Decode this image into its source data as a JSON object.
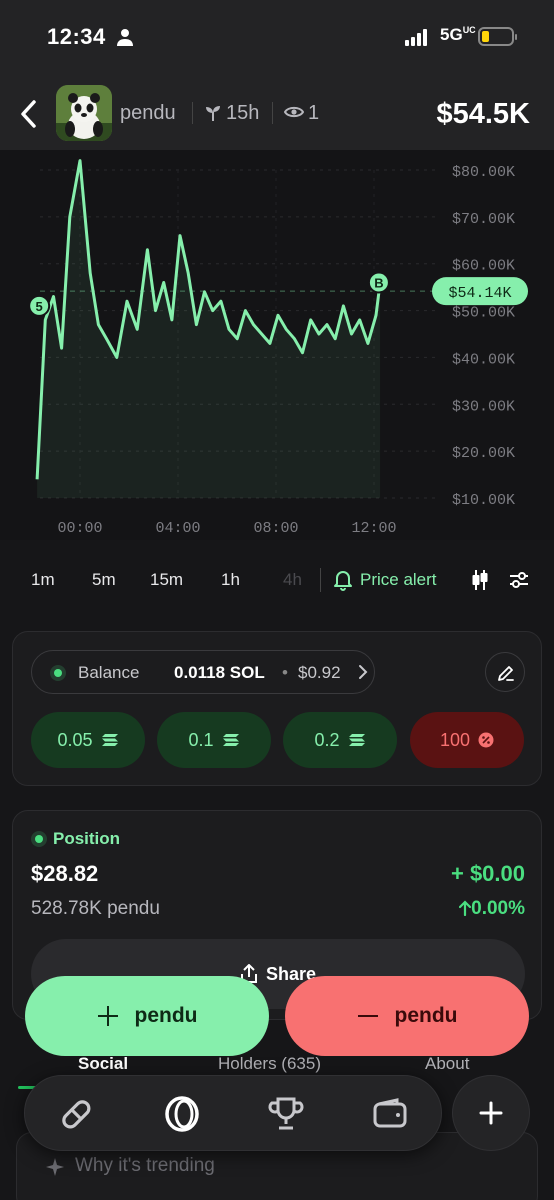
{
  "status_bar": {
    "time": "12:34",
    "network": "5G",
    "network_sub": "UC"
  },
  "header": {
    "token_name": "pendu",
    "age": "15h",
    "viewers": "1",
    "market_cap": "$54.5K"
  },
  "chart_data": {
    "type": "line",
    "y_ticks": [
      "$80.00K",
      "$70.00K",
      "$60.00K",
      "$50.00K",
      "$40.00K",
      "$30.00K",
      "$20.00K",
      "$10.00K"
    ],
    "x_ticks": [
      "00:00",
      "04:00",
      "08:00",
      "12:00"
    ],
    "ylim": [
      10000,
      80000
    ],
    "current_price_label": "$54.14K",
    "current_price": 54140,
    "line_color": "#86efac",
    "markers": [
      {
        "label": "5",
        "time": "-01:40",
        "value": 51000
      },
      {
        "label": "B",
        "time": "12:12",
        "value": 56000
      }
    ],
    "x": [
      "-01:45",
      "-01:25",
      "-01:05",
      "-00:45",
      "-00:25",
      "00:00",
      "00:25",
      "00:45",
      "01:05",
      "01:30",
      "01:55",
      "02:20",
      "02:45",
      "03:05",
      "03:25",
      "03:45",
      "04:05",
      "04:25",
      "04:45",
      "05:05",
      "05:25",
      "05:45",
      "06:05",
      "06:25",
      "06:45",
      "07:05",
      "07:25",
      "07:45",
      "08:05",
      "08:25",
      "08:45",
      "09:05",
      "09:25",
      "09:45",
      "10:05",
      "10:25",
      "10:45",
      "11:05",
      "11:25",
      "11:45",
      "12:05",
      "12:15"
    ],
    "values": [
      14000,
      48000,
      53000,
      42000,
      70000,
      82000,
      58000,
      47000,
      44000,
      40000,
      52000,
      46000,
      63000,
      50000,
      56000,
      48000,
      66000,
      58000,
      47000,
      54000,
      50000,
      52000,
      46000,
      44000,
      50000,
      47000,
      45000,
      43000,
      49000,
      46000,
      44000,
      41000,
      48000,
      45000,
      47000,
      44000,
      51000,
      45000,
      48000,
      43000,
      49000,
      56000
    ]
  },
  "timeframes": [
    "1m",
    "5m",
    "15m",
    "1h",
    "4h"
  ],
  "price_alert_label": "Price alert",
  "balance": {
    "label": "Balance",
    "sol": "0.0118 SOL",
    "bullet": "•",
    "usd": "$0.92"
  },
  "amounts": [
    "0.05",
    "0.1",
    "0.2",
    "100"
  ],
  "position": {
    "title": "Position",
    "value": "$28.82",
    "tokens": "528.78K pendu",
    "pnl": "+ $0.00",
    "pnl_pct": "0.00%",
    "share_label": "Share"
  },
  "buy_label": "pendu",
  "sell_label": "pendu",
  "tabs": [
    "Social",
    "Holders (635)",
    "About"
  ],
  "trending_label": "Why it's trending",
  "colors": {
    "accent_green": "#86efac",
    "sell_red": "#f87171",
    "bg": "#161618"
  }
}
